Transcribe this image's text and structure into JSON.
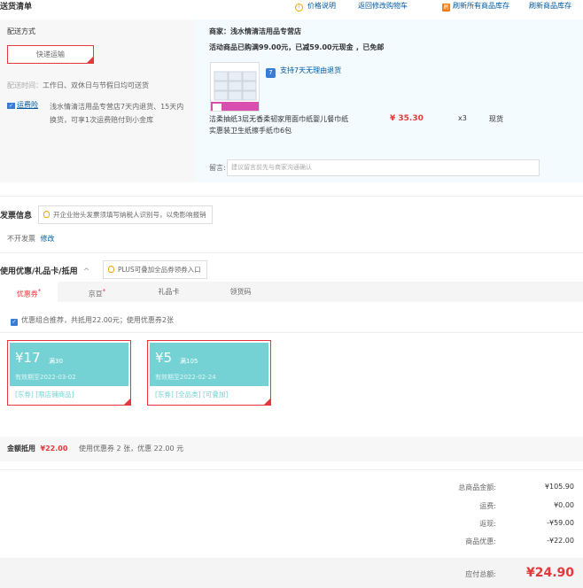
{
  "topbar": {
    "title": "送货清单",
    "price_info": "价格说明",
    "back_cart": "返回修改购物车",
    "refresh_all": "刷新所有商品库存",
    "refresh_one": "刷新商品库存"
  },
  "shipping": {
    "method_label": "配送方式",
    "method_value": "快递运输",
    "time_label": "配送时间：",
    "time_value": "工作日、双休日与节假日均可送货",
    "freight_tag": "运费险",
    "freight_text_1": "浅水情清洁用品专营店7天内退货、15天内",
    "freight_text_2": "换货，可享1次运费赔付到小金库"
  },
  "merchant": {
    "name": "商家：浅水情清洁用品专营店",
    "promo": "活动商品已购满99.00元，已减59.00元现金 ，已免邮",
    "return_policy": "支持7天无理由退货",
    "product_name_1": "洁柔抽纸3层无香柔韧家用面巾纸婴儿餐巾纸",
    "product_name_2": "实惠装卫生纸擦手纸巾6包",
    "price": "¥ 35.30",
    "qty": "x3",
    "stock": "现货",
    "remark_label": "留言:",
    "remark_placeholder": "建议留言前先与商家沟通确认"
  },
  "invoice": {
    "title": "发票信息",
    "tip": "开企业抬头发票须填写纳税人识别号，以免影响报销",
    "value": "不开发票",
    "edit": "修改"
  },
  "discount": {
    "title": "使用优惠/礼品卡/抵用",
    "chevron": "^",
    "plus_tip": "PLUS可叠加全品券领券入口",
    "tabs": [
      {
        "label": "优惠券",
        "star": "*"
      },
      {
        "label": "京豆",
        "star": "*"
      },
      {
        "label": "礼品卡",
        "star": ""
      },
      {
        "label": "领货码",
        "star": ""
      }
    ],
    "combo_text": "优惠组合推荐，共抵用22.00元；使用优惠券2张",
    "coupons": [
      {
        "amount": "¥17",
        "cond": "满30",
        "expire": "有效期至2022-03-02",
        "scope": "[东券] [限店铺商品]"
      },
      {
        "amount": "¥5",
        "cond": "满105",
        "expire": "有效期至2022-02-24",
        "scope": "[东券] [全品类] [可叠加]"
      }
    ],
    "summary_label": "金额抵用",
    "summary_amount": "¥22.00",
    "summary_text": "使用优惠券 2 张，优惠 22.00 元"
  },
  "totals": {
    "rows": [
      {
        "label": "总商品金额:",
        "value": "¥105.90"
      },
      {
        "label": "运费:",
        "value": "¥0.00"
      },
      {
        "label": "返现:",
        "value": "-¥59.00"
      },
      {
        "label": "商品优惠:",
        "value": "-¥22.00"
      }
    ],
    "payable_label": "应付总额:",
    "payable_value": "¥24.90"
  },
  "colors": {
    "accent": "#e4393c",
    "link": "#005aa0",
    "coupon": "#74d2d4"
  }
}
